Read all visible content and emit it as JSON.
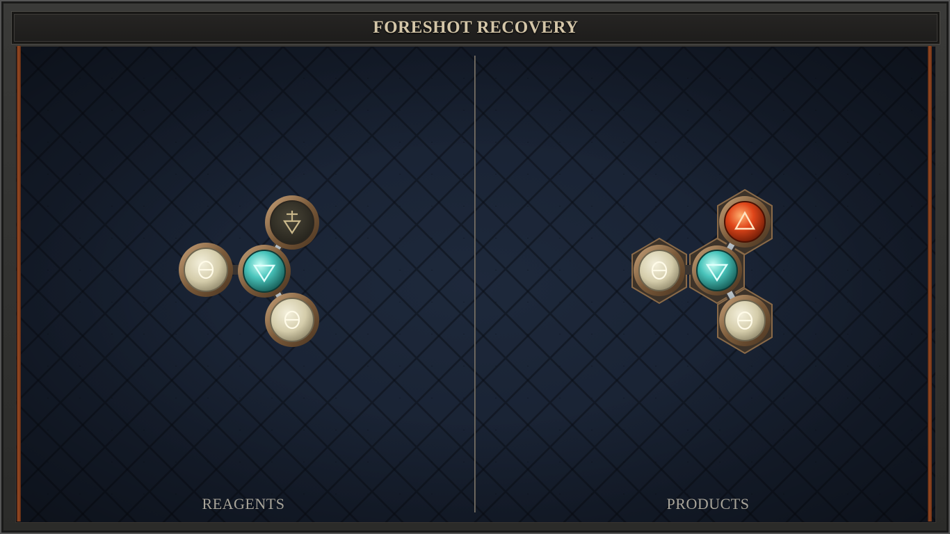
{
  "title": "FORESHOT RECOVERY",
  "panels": {
    "reagents_label": "REAGENTS",
    "products_label": "PRODUCTS"
  },
  "colors": {
    "board": "#172030",
    "title_text": "#d4c6a8",
    "label_text": "#a9a59a",
    "salt": "#d8d2b6",
    "water": "#3fb6b0",
    "fire": "#d2481a",
    "bronze": "#8a6a48"
  },
  "reagents": {
    "atoms": [
      {
        "element": "quicksilver-symbol",
        "glyph": "∇̅"
      },
      {
        "element": "water-symbol",
        "glyph": "▽"
      },
      {
        "element": "salt-symbol",
        "glyph": "θ"
      },
      {
        "element": "salt-symbol",
        "glyph": "θ"
      }
    ]
  },
  "products": {
    "atoms": [
      {
        "element": "fire-symbol",
        "glyph": "△"
      },
      {
        "element": "water-symbol",
        "glyph": "▽"
      },
      {
        "element": "salt-symbol",
        "glyph": "θ"
      },
      {
        "element": "salt-symbol",
        "glyph": "θ"
      }
    ]
  }
}
